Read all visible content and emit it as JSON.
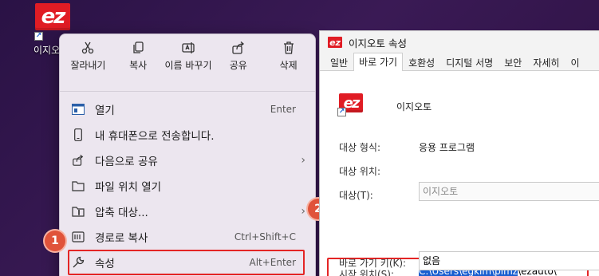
{
  "desktop": {
    "icon_label": "이지오토",
    "logo_text": "ez"
  },
  "context_menu": {
    "top_actions": [
      {
        "label": "잘라내기",
        "icon": "scissors-icon"
      },
      {
        "label": "복사",
        "icon": "copy-icon"
      },
      {
        "label": "이름 바꾸기",
        "icon": "rename-icon"
      },
      {
        "label": "공유",
        "icon": "share-icon"
      },
      {
        "label": "삭제",
        "icon": "trash-icon"
      }
    ],
    "items": [
      {
        "label": "열기",
        "shortcut": "Enter",
        "icon": "open-icon"
      },
      {
        "label": "내 휴대폰으로 전송합니다.",
        "shortcut": "",
        "icon": "phone-icon"
      },
      {
        "label": "다음으로 공유",
        "shortcut": "",
        "icon": "share-icon",
        "submenu": "›"
      },
      {
        "label": "파일 위치 열기",
        "shortcut": "",
        "icon": "folder-icon"
      },
      {
        "label": "압축 대상...",
        "shortcut": "",
        "icon": "zip-icon",
        "submenu": "›"
      },
      {
        "label": "경로로 복사",
        "shortcut": "Ctrl+Shift+C",
        "icon": "copy-path-icon"
      },
      {
        "label": "속성",
        "shortcut": "Alt+Enter",
        "icon": "wrench-icon"
      }
    ]
  },
  "badges": {
    "one": "1",
    "two": "2"
  },
  "properties": {
    "title": "이지오토 속성",
    "tabs": [
      "일반",
      "바로 가기",
      "호환성",
      "디지털 서명",
      "보안",
      "자세히",
      "이"
    ],
    "app_name": "이지오토",
    "target_type_label": "대상 형식:",
    "target_type_value": "응용 프로그램",
    "target_location_label": "대상 위치:",
    "target_label": "대상(T):",
    "target_value": "이지오토",
    "start_in_label": "시작 위치(S):",
    "start_in_selected": "C:\\Users\\egkim\\pimz",
    "start_in_rest": "\\ezauto\\",
    "shortcut_key_label": "바로 가기 키(K):",
    "shortcut_key_value": "없음"
  }
}
